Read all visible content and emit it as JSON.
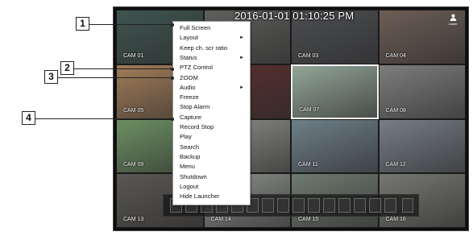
{
  "screen": {
    "clock": "2016-01-01 01:10:25 PM",
    "user_label": "Lawer"
  },
  "cameras": [
    {
      "label": "CAM 01",
      "selected": false,
      "bg": "#3f5450"
    },
    {
      "label": "",
      "selected": false,
      "bg": "#5e605c"
    },
    {
      "label": "CAM 03",
      "selected": false,
      "bg": "#4c4e51"
    },
    {
      "label": "CAM 04",
      "selected": false,
      "bg": "#6c5e55"
    },
    {
      "label": "CAM 05",
      "selected": false,
      "bg": "#a17c58"
    },
    {
      "label": "",
      "selected": false,
      "bg": "#5a2f2e"
    },
    {
      "label": "CAM 07",
      "selected": true,
      "bg": "#93a597"
    },
    {
      "label": "CAM 08",
      "selected": false,
      "bg": "#7d7e7c"
    },
    {
      "label": "CAM 09",
      "selected": false,
      "bg": "#6c8f62"
    },
    {
      "label": "",
      "selected": false,
      "bg": "#8b8b86"
    },
    {
      "label": "CAM 11",
      "selected": false,
      "bg": "#6e7f88"
    },
    {
      "label": "CAM 12",
      "selected": false,
      "bg": "#777e86"
    },
    {
      "label": "CAM 13",
      "selected": false,
      "bg": "#5a5753"
    },
    {
      "label": "CAM 14",
      "selected": false,
      "bg": "#8c8f8b"
    },
    {
      "label": "CAM 15",
      "selected": false,
      "bg": "#707a70"
    },
    {
      "label": "CAM 16",
      "selected": false,
      "bg": "#777772"
    }
  ],
  "context_menu": {
    "items": [
      {
        "label": "Full Screen",
        "has_submenu": false
      },
      {
        "label": "Layout",
        "has_submenu": true
      },
      {
        "label": "Keep ch. scr ratio",
        "has_submenu": false
      },
      {
        "label": "Status",
        "has_submenu": true
      },
      {
        "label": "PTZ Control",
        "has_submenu": false
      },
      {
        "label": "ZOOM",
        "has_submenu": false
      },
      {
        "label": "Audio",
        "has_submenu": true
      },
      {
        "label": "Freeze",
        "has_submenu": false
      },
      {
        "label": "Stop Alarm",
        "has_submenu": false
      },
      {
        "label": "Capture",
        "has_submenu": false
      },
      {
        "label": "Record Stop",
        "has_submenu": false
      },
      {
        "label": "Play",
        "has_submenu": false
      },
      {
        "label": "Search",
        "has_submenu": false
      },
      {
        "label": "Backup",
        "has_submenu": false
      },
      {
        "label": "Menu",
        "has_submenu": false
      },
      {
        "label": "Shutdown",
        "has_submenu": false
      },
      {
        "label": "Logout",
        "has_submenu": false
      },
      {
        "label": "Hide Launcher",
        "has_submenu": false
      }
    ],
    "submenu_arrow": "►"
  },
  "callouts": [
    {
      "number": "1"
    },
    {
      "number": "2"
    },
    {
      "number": "3"
    },
    {
      "number": "4"
    }
  ],
  "icons": {
    "user": "user-icon"
  }
}
